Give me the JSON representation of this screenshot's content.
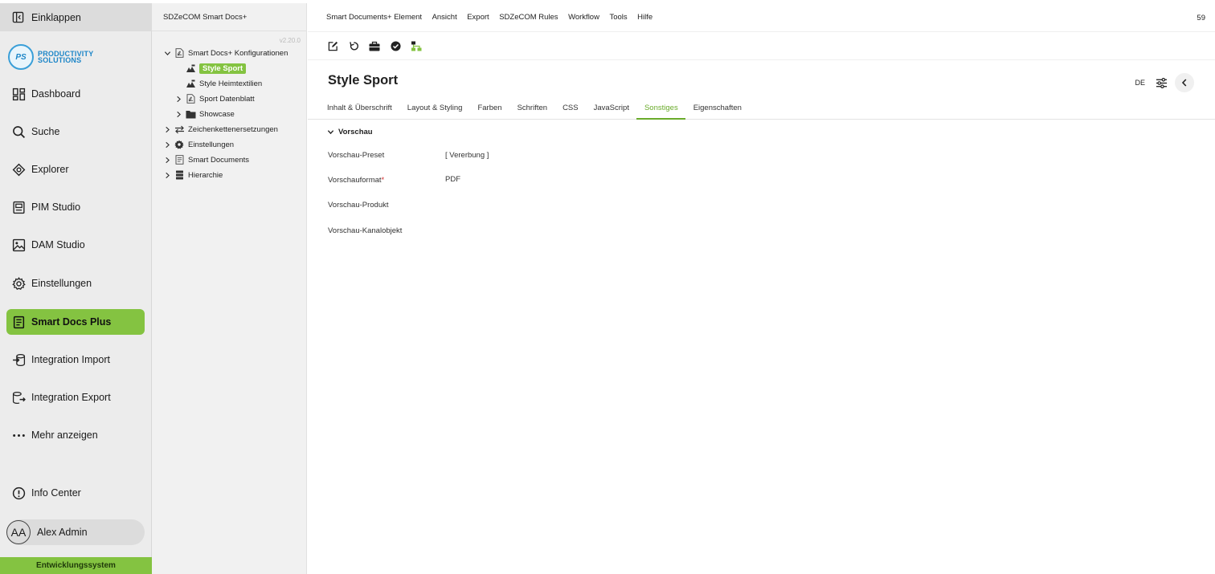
{
  "nav": {
    "collapse_label": "Einklappen",
    "logo": {
      "badge": "PS",
      "line1": "PRODUCTIVITY",
      "line2": "SOLUTIONS"
    },
    "items": [
      {
        "label": "Dashboard",
        "icon": "dashboard-icon"
      },
      {
        "label": "Suche",
        "icon": "search-icon"
      },
      {
        "label": "Explorer",
        "icon": "explorer-icon"
      },
      {
        "label": "PIM Studio",
        "icon": "pim-icon"
      },
      {
        "label": "DAM Studio",
        "icon": "image-icon"
      },
      {
        "label": "Einstellungen",
        "icon": "gear-icon"
      },
      {
        "label": "Smart Docs Plus",
        "icon": "document-icon"
      },
      {
        "label": "Integration Import",
        "icon": "import-icon"
      },
      {
        "label": "Integration Export",
        "icon": "export-icon"
      },
      {
        "label": "Mehr anzeigen",
        "icon": "more-icon"
      }
    ],
    "info_center": "Info Center",
    "user": {
      "initials": "AA",
      "name": "Alex Admin"
    },
    "environment": "Entwicklungssystem",
    "active_color": "#84c341"
  },
  "tree": {
    "header": "SDZeCOM Smart Docs+",
    "version": "v2.20.0",
    "nodes": [
      {
        "label": "Smart Docs+ Konfigurationen",
        "icon": "pdf-icon"
      },
      {
        "label": "Style Sport",
        "icon": "style-icon"
      },
      {
        "label": "Style Heimtextilien",
        "icon": "style-icon"
      },
      {
        "label": "Sport Datenblatt",
        "icon": "pdf-icon"
      },
      {
        "label": "Showcase",
        "icon": "folder-icon"
      },
      {
        "label": "Zeichenkettenersetzungen",
        "icon": "swap-icon"
      },
      {
        "label": "Einstellungen",
        "icon": "gear-icon"
      },
      {
        "label": "Smart Documents",
        "icon": "doc-icon"
      },
      {
        "label": "Hierarchie",
        "icon": "stack-icon"
      }
    ]
  },
  "main": {
    "menu": [
      "Smart Documents+ Element",
      "Ansicht",
      "Export",
      "SDZeCOM Rules",
      "Workflow",
      "Tools",
      "Hilfe"
    ],
    "count": "59",
    "title": "Style Sport",
    "language": "DE",
    "tabs": [
      "Inhalt & Überschrift",
      "Layout & Styling",
      "Farben",
      "Schriften",
      "CSS",
      "JavaScript",
      "Sonstiges",
      "Eigenschaften"
    ],
    "active_tab": "Sonstiges",
    "section_title": "Vorschau",
    "fields": {
      "preset_label": "Vorschau-Preset",
      "preset_value": "[ Vererbung ]",
      "format_label": "Vorschauformat",
      "format_value": "PDF",
      "product_label": "Vorschau-Produkt",
      "channel_label": "Vorschau-Kanalobjekt"
    },
    "accent_color": "#6aab2b"
  }
}
